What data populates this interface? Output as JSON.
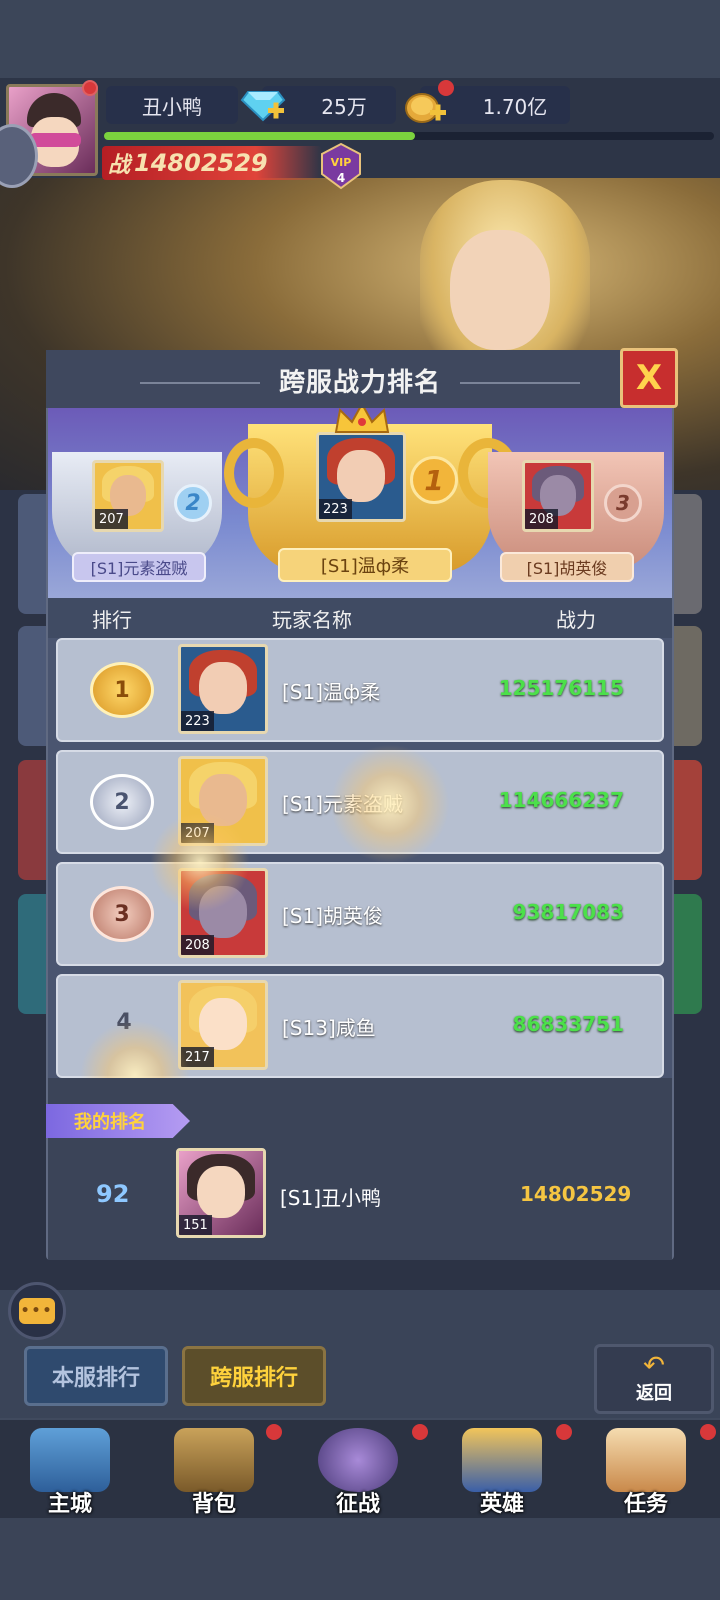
{
  "header": {
    "player_name": "丑小鸭",
    "gems": "25万",
    "gold": "1.70亿",
    "combat_power": "14802529",
    "combat_power_prefix": "战",
    "vip_label": "VIP",
    "vip_level": "4",
    "exp_progress": 0.51
  },
  "dialog": {
    "title": "跨服战力排名",
    "close_label": "X",
    "podium": [
      {
        "rank": "1",
        "name": "[S1]温ф柔",
        "level": "223"
      },
      {
        "rank": "2",
        "name": "[S1]元素盗贼",
        "level": "207"
      },
      {
        "rank": "3",
        "name": "[S1]胡英俊",
        "level": "208"
      }
    ],
    "columns": {
      "rank": "排行",
      "name": "玩家名称",
      "power": "战力"
    },
    "rows": [
      {
        "rank": "1",
        "name": "[S1]温ф柔",
        "level": "223",
        "power": "125176115"
      },
      {
        "rank": "2",
        "name": "[S1]元素盗贼",
        "level": "207",
        "power": "114666237"
      },
      {
        "rank": "3",
        "name": "[S1]胡英俊",
        "level": "208",
        "power": "93817083"
      },
      {
        "rank": "4",
        "name": "[S13]咸鱼",
        "level": "217",
        "power": "86833751"
      }
    ],
    "my_rank": {
      "tag": "我的排名",
      "rank": "92",
      "name": "[S1]丑小鸭",
      "level": "151",
      "power": "14802529"
    }
  },
  "chat": {
    "label": "•••"
  },
  "tabs": {
    "local": "本服排行",
    "cross": "跨服排行"
  },
  "back": {
    "label": "返回",
    "arrow": "↶"
  },
  "nav": [
    {
      "label": "主城"
    },
    {
      "label": "背包"
    },
    {
      "label": "征战"
    },
    {
      "label": "英雄"
    },
    {
      "label": "任务"
    }
  ],
  "colors": {
    "power_green": "#4ce04a",
    "my_power_gold": "#f5c542",
    "close_red": "#c72e2e",
    "gold_medal": "#e9b53a",
    "silver_medal": "#b9c1d6",
    "bronze_medal": "#c98b7a"
  }
}
